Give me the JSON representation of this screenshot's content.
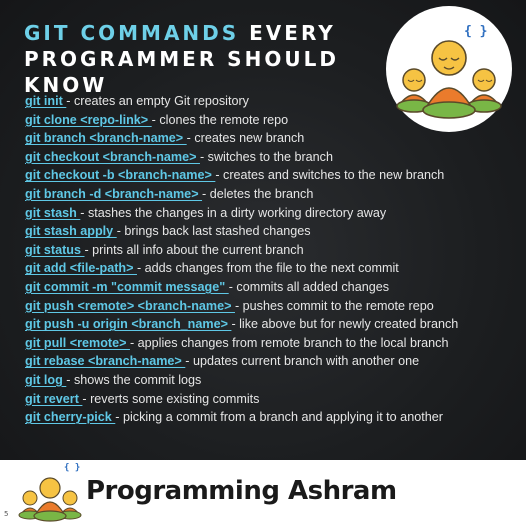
{
  "title": {
    "accent": "GIT COMMANDS",
    "rest_line1": " EVERY",
    "line2": "PROGRAMMER SHOULD KNOW"
  },
  "logo_badge": "{ }",
  "commands": [
    {
      "cmd": "git init ",
      "desc": "- creates an empty Git repository"
    },
    {
      "cmd": "git clone <repo-link> ",
      "desc": "- clones the remote repo"
    },
    {
      "cmd": "git branch <branch-name> ",
      "desc": "- creates new branch"
    },
    {
      "cmd": "git checkout <branch-name> ",
      "desc": "- switches to the branch"
    },
    {
      "cmd": "git checkout -b <branch-name> ",
      "desc": "- creates and switches to the new branch"
    },
    {
      "cmd": "git branch -d <branch-name> ",
      "desc": "- deletes the branch"
    },
    {
      "cmd": "git stash ",
      "desc": "- stashes the changes in a dirty working directory away"
    },
    {
      "cmd": "git stash apply ",
      "desc": "- brings back last stashed changes"
    },
    {
      "cmd": "git status ",
      "desc": "- prints all info about the current branch"
    },
    {
      "cmd": "git add <file-path> ",
      "desc": "- adds changes from the file to the next commit"
    },
    {
      "cmd": "git commit -m \"commit message\" ",
      "desc": "- commits all added changes"
    },
    {
      "cmd": "git push <remote> <branch-name> ",
      "desc": "- pushes commit to the remote repo"
    },
    {
      "cmd": "git push -u origin <branch_name> ",
      "desc": "- like above but for newly created branch"
    },
    {
      "cmd": "git pull <remote> ",
      "desc": "- applies changes from remote branch to the local branch"
    },
    {
      "cmd": "git rebase <branch-name> ",
      "desc": "- updates current branch with another one"
    },
    {
      "cmd": "git log ",
      "desc": "- shows the commit logs"
    },
    {
      "cmd": "git revert ",
      "desc": "- reverts some existing commits"
    },
    {
      "cmd": "git cherry-pick ",
      "desc": "- picking a commit from a branch and applying it to another"
    }
  ],
  "footer": {
    "brand": "Programming Ashram",
    "logo_badge": "{ }",
    "page_number": "5"
  },
  "colors": {
    "accent": "#5fc8e6",
    "background": "#1d1f21",
    "text": "#e6e6e6",
    "footer_bg": "#ffffff"
  }
}
